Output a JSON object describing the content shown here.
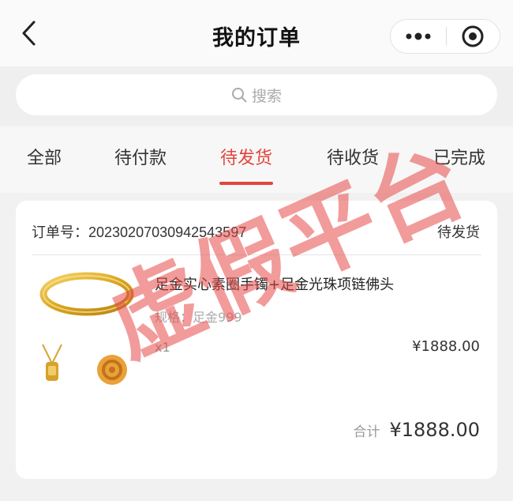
{
  "navbar": {
    "title": "我的订单",
    "back_icon": "chevron-left-icon",
    "more_icon": "more-dots-icon",
    "close_icon": "target-circle-icon"
  },
  "search": {
    "placeholder": "搜索",
    "icon": "search-icon"
  },
  "tabs": [
    {
      "label": "全部",
      "active": false
    },
    {
      "label": "待付款",
      "active": false
    },
    {
      "label": "待发货",
      "active": true
    },
    {
      "label": "待收货",
      "active": false
    },
    {
      "label": "已完成",
      "active": false
    }
  ],
  "order": {
    "order_no_label": "订单号：",
    "order_no": "20230207030942543597",
    "status": "待发货",
    "product": {
      "title": "足金实心素圈手镯+足金光珠项链佛头",
      "spec_label": "规格：",
      "spec_value": "足金999",
      "quantity": "x1",
      "price": "¥1888.00",
      "image": "gold-bracelet-necklace-image"
    },
    "total_label": "合计",
    "total_value": "¥1888.00"
  },
  "watermark": {
    "text": "虚假平台"
  },
  "colors": {
    "accent": "#e2453c",
    "watermark": "#e84848",
    "background": "#f1f1f1"
  }
}
